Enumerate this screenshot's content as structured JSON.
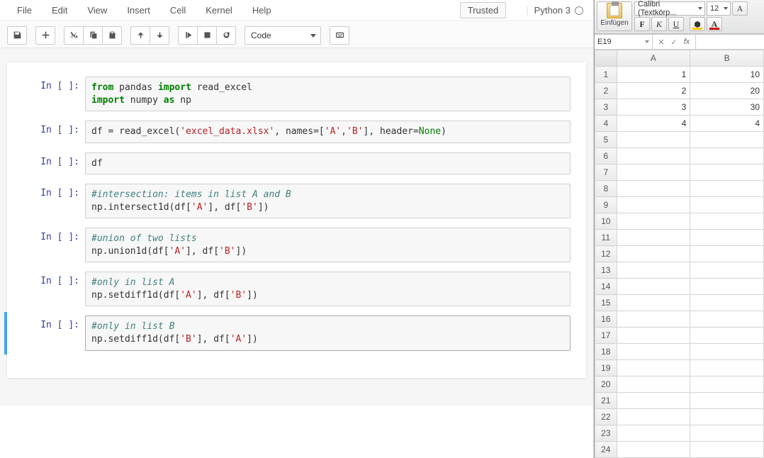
{
  "jupyter": {
    "menu": [
      "File",
      "Edit",
      "View",
      "Insert",
      "Cell",
      "Kernel",
      "Help"
    ],
    "trusted": "Trusted",
    "kernel": "Python 3",
    "cell_type": "Code",
    "prompt": "In [ ]:",
    "cells": [
      {
        "lines": [
          {
            "t": [
              {
                "c": "kw",
                "v": "from"
              },
              {
                "v": " pandas "
              },
              {
                "c": "kw",
                "v": "import"
              },
              {
                "v": " read_excel"
              }
            ]
          },
          {
            "t": [
              {
                "c": "kw",
                "v": "import"
              },
              {
                "v": " numpy "
              },
              {
                "c": "kw",
                "v": "as"
              },
              {
                "v": " np"
              }
            ]
          }
        ]
      },
      {
        "lines": [
          {
            "t": [
              {
                "v": "df = read_excel("
              },
              {
                "c": "str",
                "v": "'excel_data.xlsx'"
              },
              {
                "v": ", names=["
              },
              {
                "c": "str",
                "v": "'A'"
              },
              {
                "v": ","
              },
              {
                "c": "str",
                "v": "'B'"
              },
              {
                "v": "], header="
              },
              {
                "c": "cst",
                "v": "None"
              },
              {
                "v": ")"
              }
            ]
          }
        ]
      },
      {
        "lines": [
          {
            "t": [
              {
                "v": "df"
              }
            ]
          }
        ]
      },
      {
        "lines": [
          {
            "t": [
              {
                "c": "cm",
                "v": "#intersection: items in list A and B"
              }
            ]
          },
          {
            "t": [
              {
                "v": "np.intersect1d(df["
              },
              {
                "c": "str",
                "v": "'A'"
              },
              {
                "v": "], df["
              },
              {
                "c": "str",
                "v": "'B'"
              },
              {
                "v": "])"
              }
            ]
          }
        ]
      },
      {
        "lines": [
          {
            "t": [
              {
                "c": "cm",
                "v": "#union of two lists"
              }
            ]
          },
          {
            "t": [
              {
                "v": "np.union1d(df["
              },
              {
                "c": "str",
                "v": "'A'"
              },
              {
                "v": "], df["
              },
              {
                "c": "str",
                "v": "'B'"
              },
              {
                "v": "])"
              }
            ]
          }
        ]
      },
      {
        "lines": [
          {
            "t": [
              {
                "c": "cm",
                "v": "#only in list A"
              }
            ]
          },
          {
            "t": [
              {
                "v": "np.setdiff1d(df["
              },
              {
                "c": "str",
                "v": "'A'"
              },
              {
                "v": "], df["
              },
              {
                "c": "str",
                "v": "'B'"
              },
              {
                "v": "])"
              }
            ]
          }
        ]
      },
      {
        "selected": true,
        "lines": [
          {
            "t": [
              {
                "c": "cm",
                "v": "#only in list B"
              }
            ]
          },
          {
            "t": [
              {
                "v": "np.setdiff1d(df["
              },
              {
                "c": "str",
                "v": "'B'"
              },
              {
                "v": "], df["
              },
              {
                "c": "str",
                "v": "'A'"
              },
              {
                "v": "])"
              }
            ]
          }
        ]
      }
    ]
  },
  "excel": {
    "paste_label": "Einfügen",
    "font_name": "Calibri (Textkörp...",
    "font_size": "12",
    "bold": "F",
    "italic": "K",
    "underline": "U",
    "fill_color": "#ffcc00",
    "text_color": "#cc0000",
    "name_box": "E19",
    "fx": "fx",
    "columns": [
      "A",
      "B"
    ],
    "rows": 24,
    "data": {
      "1": {
        "A": "1",
        "B": "10"
      },
      "2": {
        "A": "2",
        "B": "20"
      },
      "3": {
        "A": "3",
        "B": "30"
      },
      "4": {
        "A": "4",
        "B": "4"
      }
    }
  }
}
